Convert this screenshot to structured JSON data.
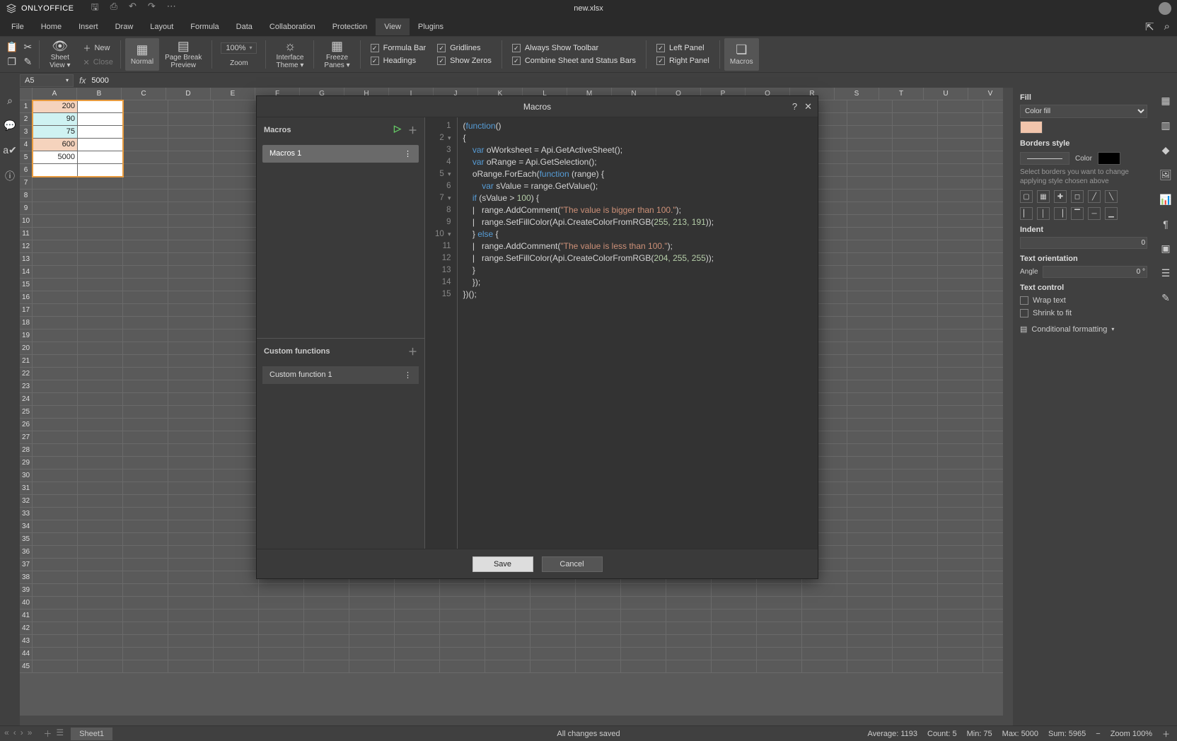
{
  "app": {
    "name": "ONLYOFFICE",
    "doc": "new.xlsx"
  },
  "menu": {
    "tabs": [
      "File",
      "Home",
      "Insert",
      "Draw",
      "Layout",
      "Formula",
      "Data",
      "Collaboration",
      "Protection",
      "View",
      "Plugins"
    ],
    "active": 9
  },
  "ribbon": {
    "new": "New",
    "close": "Close",
    "sheetview": "Sheet\nView",
    "normal": "Normal",
    "pagebreak": "Page Break\nPreview",
    "zoompct": "100%",
    "zoom": "Zoom",
    "iftheme": "Interface\nTheme",
    "freeze": "Freeze\nPanes",
    "formula_bar": "Formula Bar",
    "headings": "Headings",
    "gridlines": "Gridlines",
    "showzeros": "Show Zeros",
    "alwaystoolbar": "Always Show Toolbar",
    "combinebars": "Combine Sheet and Status Bars",
    "leftpanel": "Left Panel",
    "rightpanel": "Right Panel",
    "macros": "Macros"
  },
  "formula": {
    "cell": "A5",
    "val": "5000"
  },
  "cells": {
    "A1": "200",
    "A2": "90",
    "A3": "75",
    "A4": "600",
    "A5": "5000",
    "A1c": "pink",
    "A2c": "teal",
    "A3c": "teal",
    "A4c": "pink",
    "A5c": "sel"
  },
  "right": {
    "fill": "Fill",
    "filltype": "Color fill",
    "swatch": "#f2c5ac",
    "borders": "Borders style",
    "color": "Color",
    "hint": "Select borders you want to change applying style chosen above",
    "indent": "Indent",
    "indentval": "0",
    "textorient": "Text orientation",
    "angle": "Angle",
    "angleval": "0 °",
    "textctrl": "Text control",
    "wrap": "Wrap text",
    "shrink": "Shrink to fit",
    "condfmt": "Conditional formatting"
  },
  "dialog": {
    "title": "Macros",
    "macros_h": "Macros",
    "macro1": "Macros 1",
    "custom_h": "Custom functions",
    "cf1": "Custom function 1",
    "save": "Save",
    "cancel": "Cancel",
    "code": {
      "l1a": "(",
      "l1b": "function",
      "l1c": "()",
      "l2": "{",
      "l3a": "    var",
      "l3b": " oWorksheet = Api.GetActiveSheet();",
      "l4a": "    var",
      "l4b": " oRange = Api.GetSelection();",
      "l5a": "    oRange.ForEach(",
      "l5b": "function",
      "l5c": " (range) {",
      "l6a": "        var",
      "l6b": " sValue = range.GetValue();",
      "l7a": "    if",
      "l7b": " (sValue > ",
      "l7n": "100",
      "l7c": ") {",
      "l8a": "    |   range.AddComment(",
      "l8s": "\"The value is bigger than 100.\"",
      "l8b": ");",
      "l9a": "    |   range.SetFillColor(Api.CreateColorFromRGB(",
      "l9n": "255, 213, 191",
      "l9b": "));",
      "l10a": "    } ",
      "l10b": "else",
      "l10c": " {",
      "l11a": "    |   range.AddComment(",
      "l11s": "\"The value is less than 100.\"",
      "l11b": ");",
      "l12a": "    |   range.SetFillColor(Api.CreateColorFromRGB(",
      "l12n": "204, 255, 255",
      "l12b": "));",
      "l13": "    }",
      "l14": "    });",
      "l15": "})();"
    }
  },
  "sheet": {
    "name": "Sheet1"
  },
  "status": {
    "saved": "All changes saved",
    "avg": "Average: 1193",
    "cnt": "Count: 5",
    "min": "Min: 75",
    "max": "Max: 5000",
    "sum": "Sum: 5965",
    "zoom": "Zoom 100%"
  }
}
